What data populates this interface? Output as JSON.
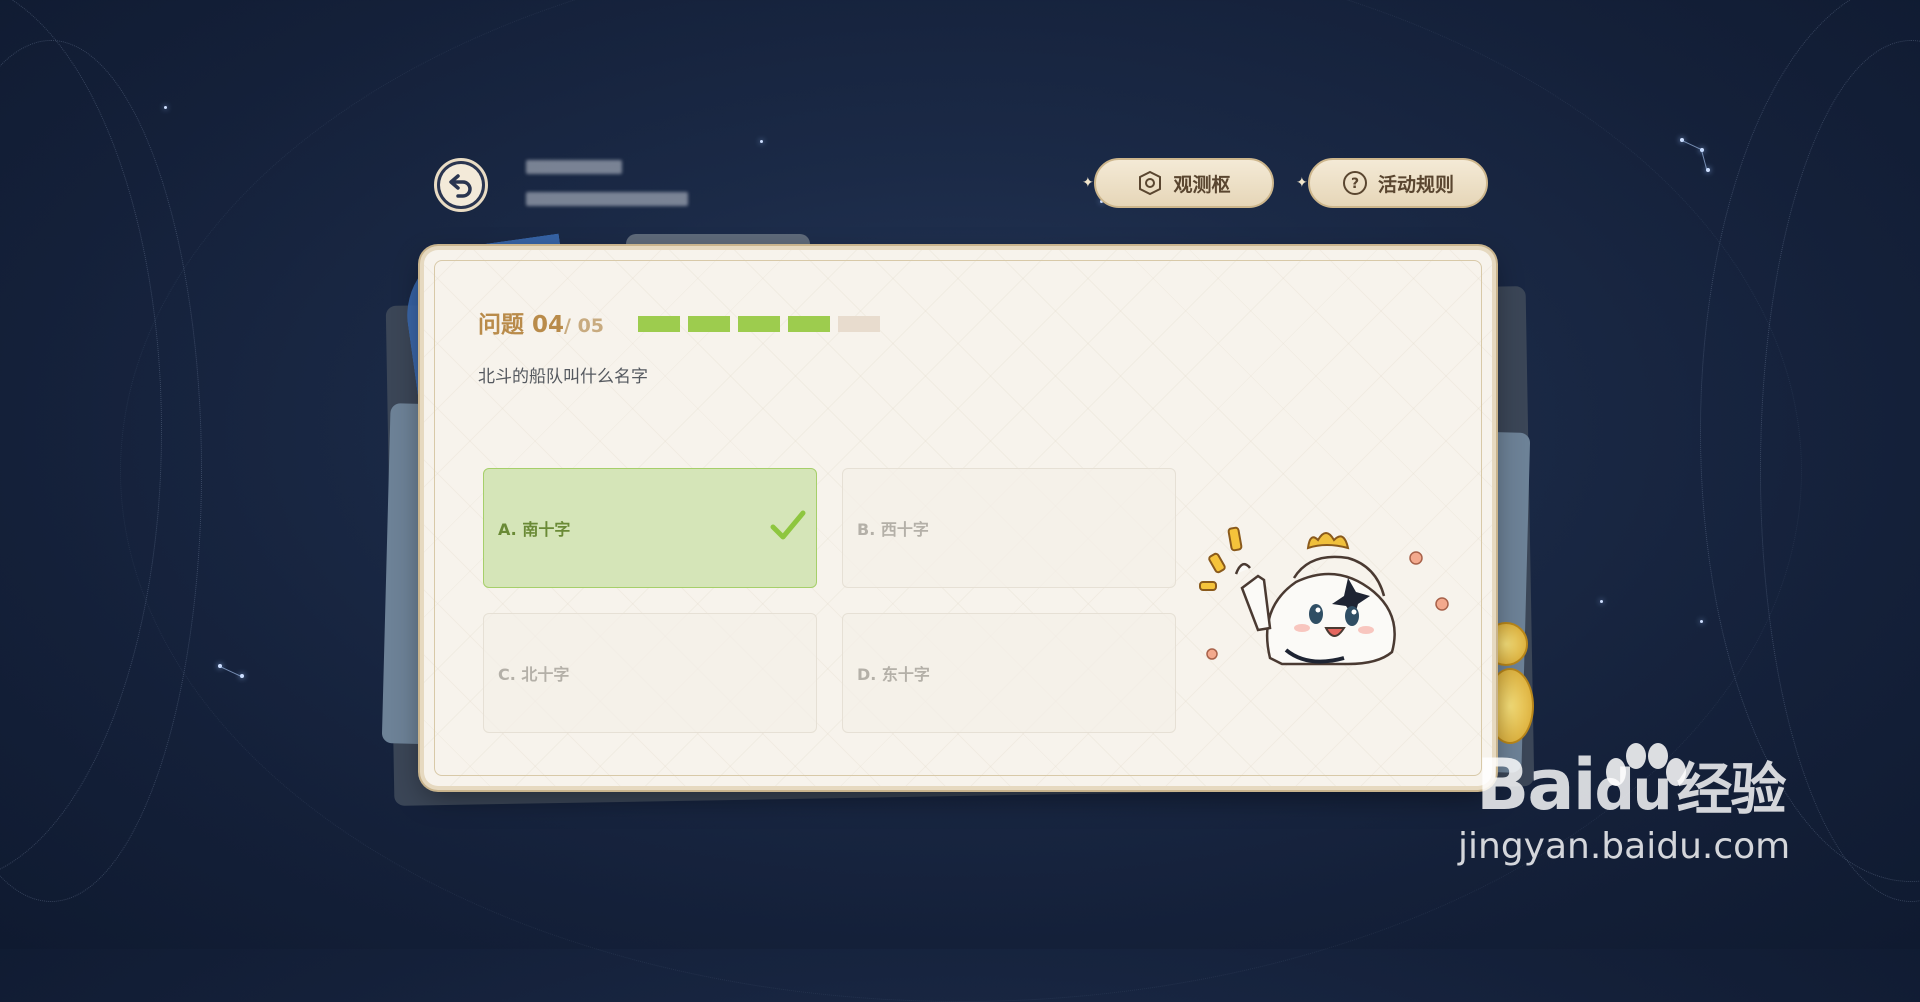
{
  "header": {
    "observe_button": "观测枢",
    "rules_button": "活动规则"
  },
  "quiz": {
    "label": "问题 04",
    "total": "/ 05",
    "progress_done": 4,
    "progress_total": 5,
    "question": "北斗的船队叫什么名字",
    "options": [
      {
        "text": "A. 南十字",
        "state": "correct"
      },
      {
        "text": "B. 西十字",
        "state": "default"
      },
      {
        "text": "C. 北十字",
        "state": "default"
      },
      {
        "text": "D. 东十字",
        "state": "default"
      }
    ]
  },
  "colors": {
    "progress_done": "#9dcc4e",
    "correct_bg": "#d5e5b8",
    "title": "#b98b4a"
  },
  "watermark": {
    "brand": "Bai",
    "brand_du": "du",
    "brand_cn": "经验",
    "url": "jingyan.baidu.com"
  }
}
